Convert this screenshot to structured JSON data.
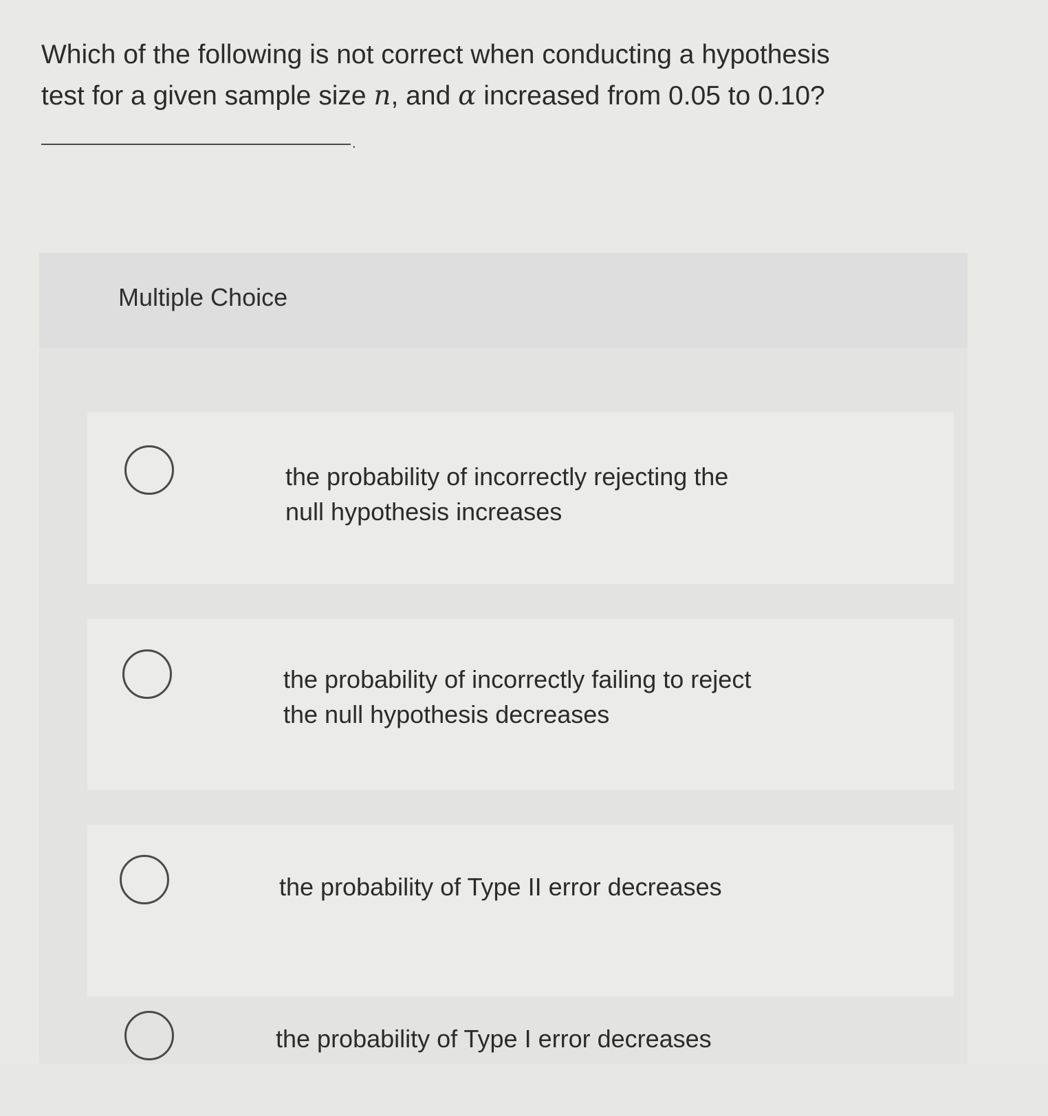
{
  "question": {
    "line1": "Which of the following is not correct when conducting a hypothesis",
    "line2_prefix": "test for a given sample size ",
    "var_n": "n",
    "line2_mid": ", and ",
    "var_alpha": "α",
    "line2_suffix": " increased from 0.05 to 0.10?"
  },
  "answer_blank": {
    "trailing": "."
  },
  "multiple_choice": {
    "title": "Multiple Choice",
    "options": [
      {
        "line1": "the probability of incorrectly rejecting the",
        "line2": "null hypothesis increases"
      },
      {
        "line1": "the probability of incorrectly failing to reject",
        "line2": "the null hypothesis decreases"
      },
      {
        "line1": "the probability of Type II error decreases",
        "line2": ""
      },
      {
        "line1": "the probability of Type I error decreases",
        "line2": ""
      }
    ]
  }
}
